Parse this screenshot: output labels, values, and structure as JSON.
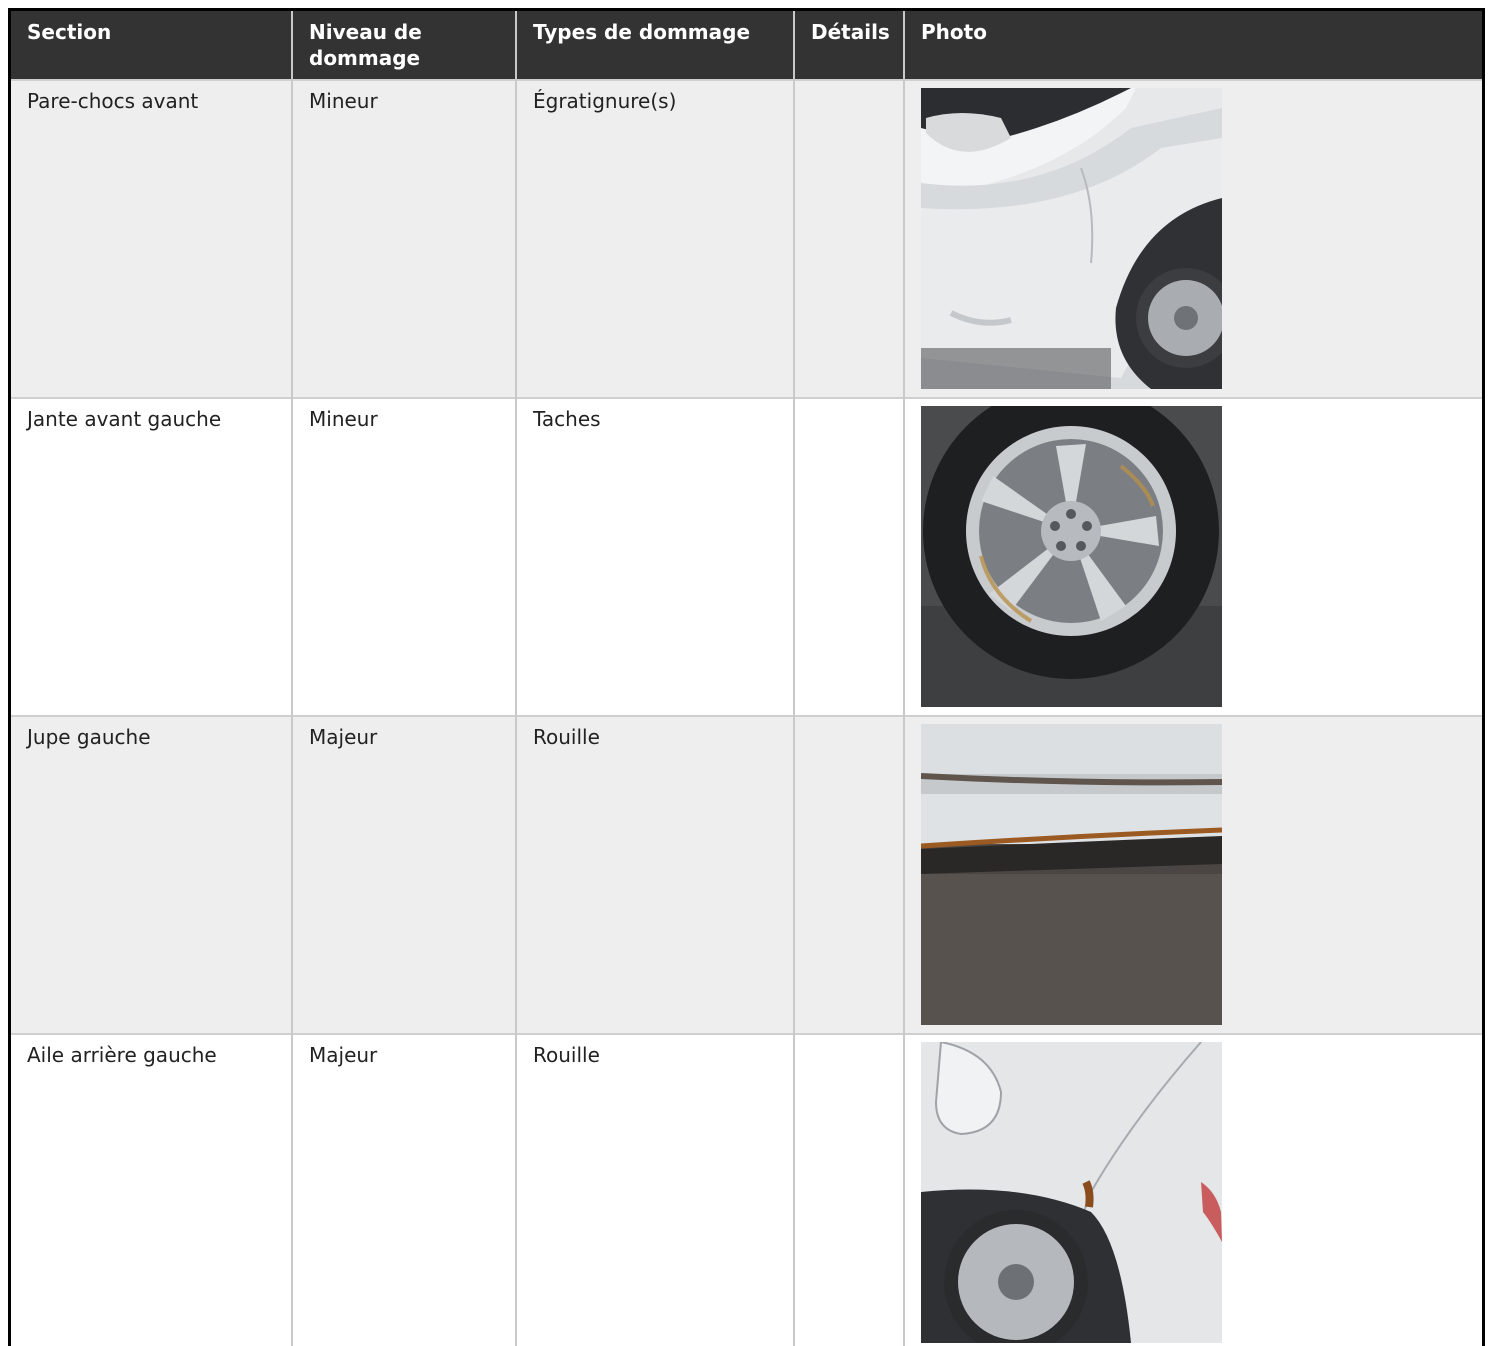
{
  "table": {
    "headers": {
      "section": "Section",
      "level": "Niveau de dommage",
      "types": "Types de dommage",
      "details": "Détails",
      "photo": "Photo"
    },
    "rows": [
      {
        "section": "Pare-chocs avant",
        "level": "Mineur",
        "types": "Égratignure(s)",
        "details": "",
        "photo": "front-bumper-photo"
      },
      {
        "section": "Jante avant gauche",
        "level": "Mineur",
        "types": "Taches",
        "details": "",
        "photo": "front-left-rim-photo"
      },
      {
        "section": "Jupe gauche",
        "level": "Majeur",
        "types": "Rouille",
        "details": "",
        "photo": "left-skirt-photo"
      },
      {
        "section": "Aile arrière gauche",
        "level": "Majeur",
        "types": "Rouille",
        "details": "",
        "photo": "rear-left-fender-photo"
      }
    ]
  }
}
